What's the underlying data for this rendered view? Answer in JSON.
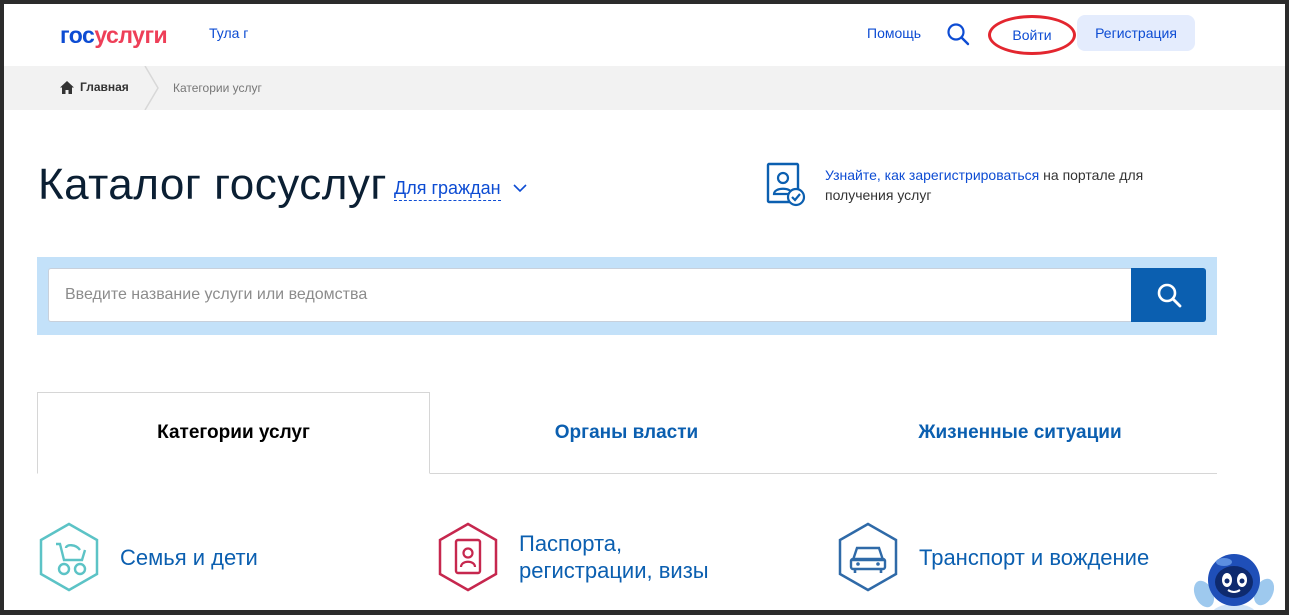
{
  "header": {
    "logo_part1": "гос",
    "logo_part2": "услуги",
    "city": "Тула г",
    "help": "Помощь",
    "login": "Войти",
    "register": "Регистрация"
  },
  "breadcrumb": {
    "home": "Главная",
    "current": "Категории услуг"
  },
  "page": {
    "title": "Каталог госуслуг",
    "audience": "Для граждан",
    "reg_link": "Узнайте, как зарегистрироваться",
    "reg_rest": " на портале для получения услуг"
  },
  "search": {
    "placeholder": "Введите название услуги или ведомства",
    "value": ""
  },
  "tabs": [
    {
      "label": "Категории услуг"
    },
    {
      "label": "Органы власти"
    },
    {
      "label": "Жизненные ситуации"
    }
  ],
  "categories": [
    {
      "label": "Семья и дети",
      "color": "#5cc3c6"
    },
    {
      "line1": "Паспорта,",
      "line2": "регистрации, визы",
      "color": "#c6274e"
    },
    {
      "label": "Транспорт и вождение",
      "color": "#2f6aa8"
    }
  ],
  "colors": {
    "brand_blue": "#0d4cd3",
    "brand_red": "#ee3f58",
    "search_bg": "#c3e1f9",
    "search_button": "#0b5fb0",
    "highlight_circle": "#e3262f"
  }
}
